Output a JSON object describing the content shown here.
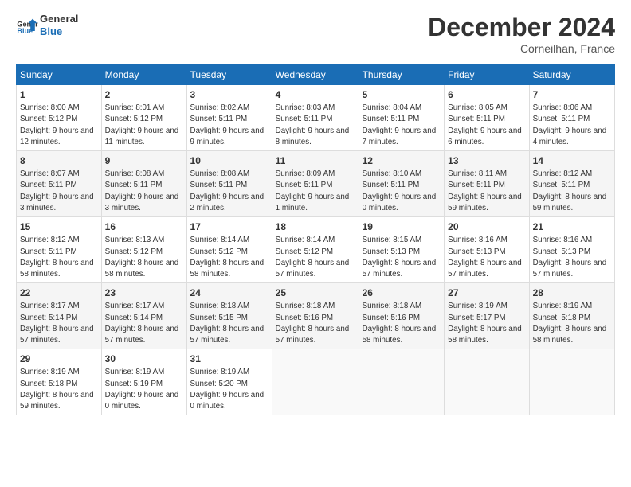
{
  "header": {
    "logo_line1": "General",
    "logo_line2": "Blue",
    "month_title": "December 2024",
    "location": "Corneilhan, France"
  },
  "days_of_week": [
    "Sunday",
    "Monday",
    "Tuesday",
    "Wednesday",
    "Thursday",
    "Friday",
    "Saturday"
  ],
  "weeks": [
    [
      {
        "day": "1",
        "sunrise": "8:00 AM",
        "sunset": "5:12 PM",
        "daylight": "9 hours and 12 minutes."
      },
      {
        "day": "2",
        "sunrise": "8:01 AM",
        "sunset": "5:12 PM",
        "daylight": "9 hours and 11 minutes."
      },
      {
        "day": "3",
        "sunrise": "8:02 AM",
        "sunset": "5:11 PM",
        "daylight": "9 hours and 9 minutes."
      },
      {
        "day": "4",
        "sunrise": "8:03 AM",
        "sunset": "5:11 PM",
        "daylight": "9 hours and 8 minutes."
      },
      {
        "day": "5",
        "sunrise": "8:04 AM",
        "sunset": "5:11 PM",
        "daylight": "9 hours and 7 minutes."
      },
      {
        "day": "6",
        "sunrise": "8:05 AM",
        "sunset": "5:11 PM",
        "daylight": "9 hours and 6 minutes."
      },
      {
        "day": "7",
        "sunrise": "8:06 AM",
        "sunset": "5:11 PM",
        "daylight": "9 hours and 4 minutes."
      }
    ],
    [
      {
        "day": "8",
        "sunrise": "8:07 AM",
        "sunset": "5:11 PM",
        "daylight": "9 hours and 3 minutes."
      },
      {
        "day": "9",
        "sunrise": "8:08 AM",
        "sunset": "5:11 PM",
        "daylight": "9 hours and 3 minutes."
      },
      {
        "day": "10",
        "sunrise": "8:08 AM",
        "sunset": "5:11 PM",
        "daylight": "9 hours and 2 minutes."
      },
      {
        "day": "11",
        "sunrise": "8:09 AM",
        "sunset": "5:11 PM",
        "daylight": "9 hours and 1 minute."
      },
      {
        "day": "12",
        "sunrise": "8:10 AM",
        "sunset": "5:11 PM",
        "daylight": "9 hours and 0 minutes."
      },
      {
        "day": "13",
        "sunrise": "8:11 AM",
        "sunset": "5:11 PM",
        "daylight": "8 hours and 59 minutes."
      },
      {
        "day": "14",
        "sunrise": "8:12 AM",
        "sunset": "5:11 PM",
        "daylight": "8 hours and 59 minutes."
      }
    ],
    [
      {
        "day": "15",
        "sunrise": "8:12 AM",
        "sunset": "5:11 PM",
        "daylight": "8 hours and 58 minutes."
      },
      {
        "day": "16",
        "sunrise": "8:13 AM",
        "sunset": "5:12 PM",
        "daylight": "8 hours and 58 minutes."
      },
      {
        "day": "17",
        "sunrise": "8:14 AM",
        "sunset": "5:12 PM",
        "daylight": "8 hours and 58 minutes."
      },
      {
        "day": "18",
        "sunrise": "8:14 AM",
        "sunset": "5:12 PM",
        "daylight": "8 hours and 57 minutes."
      },
      {
        "day": "19",
        "sunrise": "8:15 AM",
        "sunset": "5:13 PM",
        "daylight": "8 hours and 57 minutes."
      },
      {
        "day": "20",
        "sunrise": "8:16 AM",
        "sunset": "5:13 PM",
        "daylight": "8 hours and 57 minutes."
      },
      {
        "day": "21",
        "sunrise": "8:16 AM",
        "sunset": "5:13 PM",
        "daylight": "8 hours and 57 minutes."
      }
    ],
    [
      {
        "day": "22",
        "sunrise": "8:17 AM",
        "sunset": "5:14 PM",
        "daylight": "8 hours and 57 minutes."
      },
      {
        "day": "23",
        "sunrise": "8:17 AM",
        "sunset": "5:14 PM",
        "daylight": "8 hours and 57 minutes."
      },
      {
        "day": "24",
        "sunrise": "8:18 AM",
        "sunset": "5:15 PM",
        "daylight": "8 hours and 57 minutes."
      },
      {
        "day": "25",
        "sunrise": "8:18 AM",
        "sunset": "5:16 PM",
        "daylight": "8 hours and 57 minutes."
      },
      {
        "day": "26",
        "sunrise": "8:18 AM",
        "sunset": "5:16 PM",
        "daylight": "8 hours and 58 minutes."
      },
      {
        "day": "27",
        "sunrise": "8:19 AM",
        "sunset": "5:17 PM",
        "daylight": "8 hours and 58 minutes."
      },
      {
        "day": "28",
        "sunrise": "8:19 AM",
        "sunset": "5:18 PM",
        "daylight": "8 hours and 58 minutes."
      }
    ],
    [
      {
        "day": "29",
        "sunrise": "8:19 AM",
        "sunset": "5:18 PM",
        "daylight": "8 hours and 59 minutes."
      },
      {
        "day": "30",
        "sunrise": "8:19 AM",
        "sunset": "5:19 PM",
        "daylight": "9 hours and 0 minutes."
      },
      {
        "day": "31",
        "sunrise": "8:19 AM",
        "sunset": "5:20 PM",
        "daylight": "9 hours and 0 minutes."
      },
      null,
      null,
      null,
      null
    ]
  ]
}
